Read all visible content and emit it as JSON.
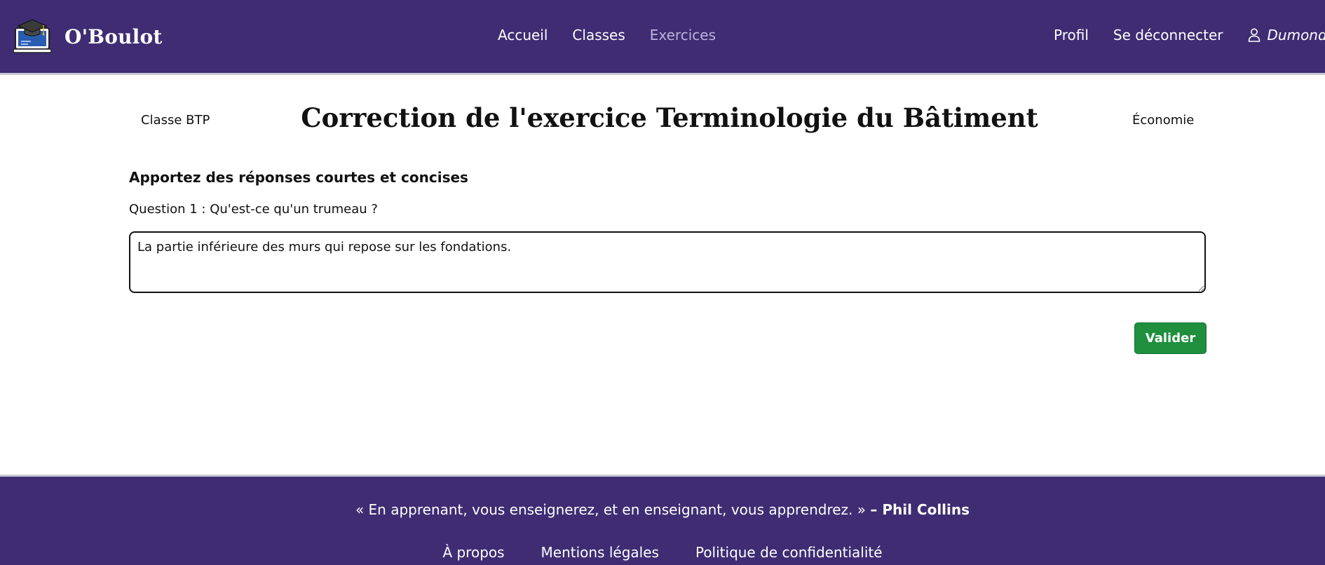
{
  "header": {
    "brand_name": "O'Boulot",
    "nav": [
      {
        "label": "Accueil"
      },
      {
        "label": "Classes"
      },
      {
        "label": "Exercices",
        "active": true
      }
    ],
    "profile_label": "Profil",
    "logout_label": "Se déconnecter",
    "user_name": "Dumond",
    "icons": {
      "logo": "graduation-laptop-logo",
      "user": "user-icon"
    },
    "colors": {
      "background": "#3f2c73",
      "active_link": "#bdb4d8"
    }
  },
  "main": {
    "class_label": "Classe BTP",
    "subject_label": "Économie",
    "title": "Correction de l'exercice Terminologie du Bâtiment",
    "instructions": "Apportez des réponses courtes et concises",
    "question": "Question 1 : Qu'est-ce qu'un trumeau ?",
    "answer_value": "La partie inférieure des murs qui repose sur les fondations.",
    "submit_label": "Valider",
    "colors": {
      "submit": "#1f8f3e"
    }
  },
  "footer": {
    "quote_text": "« En apprenant, vous enseignerez, et en enseignant, vous apprendrez. »",
    "quote_author": "– Phil Collins",
    "links": [
      {
        "label": "À propos"
      },
      {
        "label": "Mentions légales"
      },
      {
        "label": "Politique de confidentialité"
      }
    ],
    "colors": {
      "background": "#3f2c73"
    }
  }
}
